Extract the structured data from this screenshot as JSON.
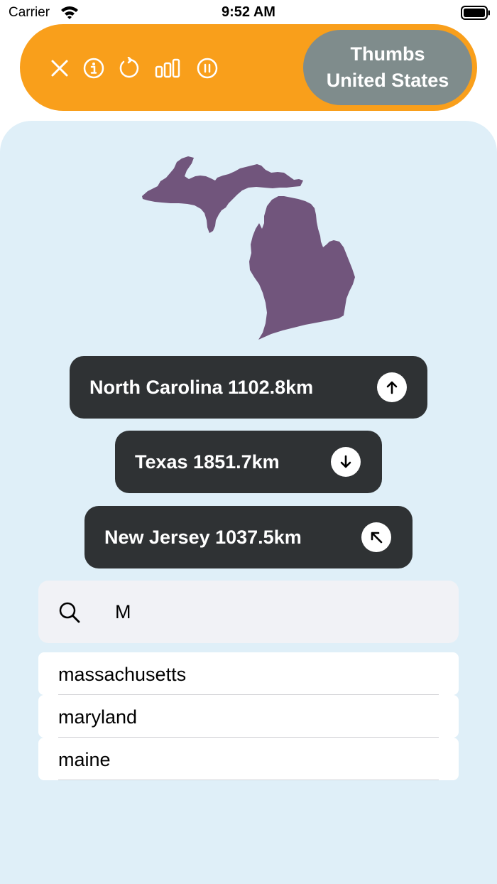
{
  "status_bar": {
    "carrier": "Carrier",
    "time": "9:52 AM",
    "icons": [
      "wifi-icon",
      "battery-icon"
    ]
  },
  "toolbar": {
    "background_color": "#f99f1b",
    "buttons": [
      {
        "name": "close-icon"
      },
      {
        "name": "info-icon"
      },
      {
        "name": "restart-icon"
      },
      {
        "name": "stats-icon"
      },
      {
        "name": "pause-icon"
      }
    ],
    "mode_line1": "Thumbs",
    "mode_line2": "United States",
    "mode_color": "#7f8c8c"
  },
  "puzzle": {
    "shape_icon": "michigan-silhouette",
    "shape_color": "#71557c"
  },
  "guesses": [
    {
      "state": "North Carolina",
      "distance": "1102.8km",
      "direction": "north",
      "text": "North Carolina  1102.8km"
    },
    {
      "state": "Texas",
      "distance": "1851.7km",
      "direction": "south",
      "text": "Texas  1851.7km"
    },
    {
      "state": "New Jersey",
      "distance": "1037.5km",
      "direction": "northwest",
      "text": "New Jersey  1037.5km"
    }
  ],
  "search": {
    "icon": "search-icon",
    "value": "M",
    "placeholder": ""
  },
  "suggestions": [
    {
      "label": "massachusetts"
    },
    {
      "label": "maryland"
    },
    {
      "label": "maine"
    }
  ]
}
